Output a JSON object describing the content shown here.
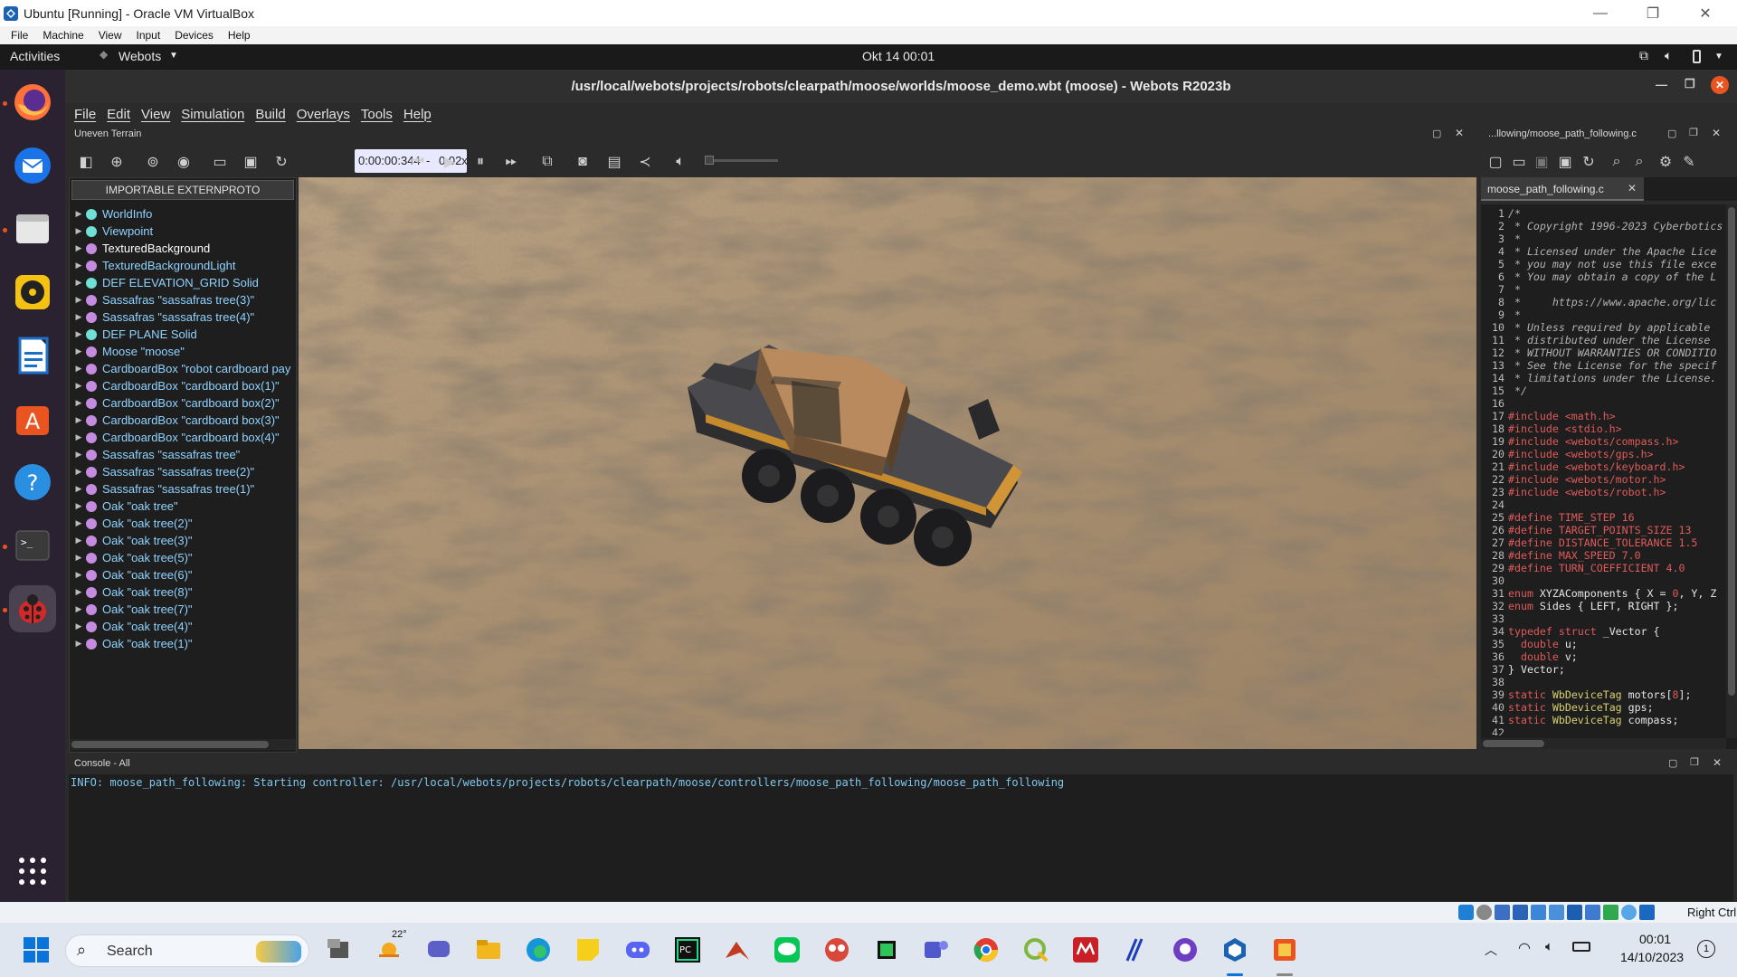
{
  "vbox": {
    "title": "Ubuntu [Running] - Oracle VM VirtualBox",
    "menu": [
      "File",
      "Machine",
      "View",
      "Input",
      "Devices",
      "Help"
    ],
    "host_key": "Right Ctrl"
  },
  "ubuntu": {
    "activities": "Activities",
    "app": "Webots",
    "clock": "Okt 14  00:01"
  },
  "webots": {
    "title": "/usr/local/webots/projects/robots/clearpath/moose/worlds/moose_demo.wbt (moose) - Webots R2023b",
    "menu": [
      "File",
      "Edit",
      "View",
      "Simulation",
      "Build",
      "Overlays",
      "Tools",
      "Help"
    ],
    "world_label": "Uneven Terrain",
    "time": "0:00:00:344",
    "speed_sep": "-",
    "speed": "0.02x",
    "importable_btn": "IMPORTABLE EXTERNPROTO",
    "tree": [
      {
        "label": "WorldInfo",
        "color": "#6ee0d6",
        "bright": false
      },
      {
        "label": "Viewpoint",
        "color": "#6ee0d6",
        "bright": false
      },
      {
        "label": "TexturedBackground",
        "color": "#c58be0",
        "bright": true
      },
      {
        "label": "TexturedBackgroundLight",
        "color": "#c58be0",
        "bright": false
      },
      {
        "label": "DEF ELEVATION_GRID Solid",
        "color": "#6ee0d6",
        "bright": false
      },
      {
        "label": "Sassafras \"sassafras tree(3)\"",
        "color": "#c58be0",
        "bright": false
      },
      {
        "label": "Sassafras \"sassafras tree(4)\"",
        "color": "#c58be0",
        "bright": false
      },
      {
        "label": "DEF PLANE Solid",
        "color": "#6ee0d6",
        "bright": false
      },
      {
        "label": "Moose \"moose\"",
        "color": "#c58be0",
        "bright": false
      },
      {
        "label": "CardboardBox \"robot cardboard pay",
        "color": "#c58be0",
        "bright": false
      },
      {
        "label": "CardboardBox \"cardboard box(1)\"",
        "color": "#c58be0",
        "bright": false
      },
      {
        "label": "CardboardBox \"cardboard box(2)\"",
        "color": "#c58be0",
        "bright": false
      },
      {
        "label": "CardboardBox \"cardboard box(3)\"",
        "color": "#c58be0",
        "bright": false
      },
      {
        "label": "CardboardBox \"cardboard box(4)\"",
        "color": "#c58be0",
        "bright": false
      },
      {
        "label": "Sassafras \"sassafras tree\"",
        "color": "#c58be0",
        "bright": false
      },
      {
        "label": "Sassafras \"sassafras tree(2)\"",
        "color": "#c58be0",
        "bright": false
      },
      {
        "label": "Sassafras \"sassafras tree(1)\"",
        "color": "#c58be0",
        "bright": false
      },
      {
        "label": "Oak \"oak tree\"",
        "color": "#c58be0",
        "bright": false
      },
      {
        "label": "Oak \"oak tree(2)\"",
        "color": "#c58be0",
        "bright": false
      },
      {
        "label": "Oak \"oak tree(3)\"",
        "color": "#c58be0",
        "bright": false
      },
      {
        "label": "Oak \"oak tree(5)\"",
        "color": "#c58be0",
        "bright": false
      },
      {
        "label": "Oak \"oak tree(6)\"",
        "color": "#c58be0",
        "bright": false
      },
      {
        "label": "Oak \"oak tree(8)\"",
        "color": "#c58be0",
        "bright": false
      },
      {
        "label": "Oak \"oak tree(7)\"",
        "color": "#c58be0",
        "bright": false
      },
      {
        "label": "Oak \"oak tree(4)\"",
        "color": "#c58be0",
        "bright": false
      },
      {
        "label": "Oak \"oak tree(1)\"",
        "color": "#c58be0",
        "bright": false
      }
    ],
    "editor_panel_title": "...llowing/moose_path_following.c",
    "editor_tab": "moose_path_following.c",
    "code": [
      {
        "n": "1",
        "segs": [
          {
            "t": "/*",
            "c": "cm"
          }
        ]
      },
      {
        "n": "2",
        "segs": [
          {
            "t": " * Copyright 1996-2023 Cyberbotics",
            "c": "cm"
          }
        ]
      },
      {
        "n": "3",
        "segs": [
          {
            "t": " *",
            "c": "cm"
          }
        ]
      },
      {
        "n": "4",
        "segs": [
          {
            "t": " * Licensed under the Apache Lice",
            "c": "cm"
          }
        ]
      },
      {
        "n": "5",
        "segs": [
          {
            "t": " * you may not use this file exce",
            "c": "cm"
          }
        ]
      },
      {
        "n": "6",
        "segs": [
          {
            "t": " * You may obtain a copy of the L",
            "c": "cm"
          }
        ]
      },
      {
        "n": "7",
        "segs": [
          {
            "t": " *",
            "c": "cm"
          }
        ]
      },
      {
        "n": "8",
        "segs": [
          {
            "t": " *     https://www.apache.org/lic",
            "c": "cm"
          }
        ]
      },
      {
        "n": "9",
        "segs": [
          {
            "t": " *",
            "c": "cm"
          }
        ]
      },
      {
        "n": "10",
        "segs": [
          {
            "t": " * Unless required by applicable",
            "c": "cm"
          }
        ]
      },
      {
        "n": "11",
        "segs": [
          {
            "t": " * distributed under the License",
            "c": "cm"
          }
        ]
      },
      {
        "n": "12",
        "segs": [
          {
            "t": " * WITHOUT WARRANTIES OR CONDITIO",
            "c": "cm"
          }
        ]
      },
      {
        "n": "13",
        "segs": [
          {
            "t": " * See the License for the specif",
            "c": "cm"
          }
        ]
      },
      {
        "n": "14",
        "segs": [
          {
            "t": " * limitations under the License.",
            "c": "cm"
          }
        ]
      },
      {
        "n": "15",
        "segs": [
          {
            "t": " */",
            "c": "cm"
          }
        ]
      },
      {
        "n": "16",
        "segs": []
      },
      {
        "n": "17",
        "segs": [
          {
            "t": "#include <math.h>",
            "c": "pp"
          }
        ]
      },
      {
        "n": "18",
        "segs": [
          {
            "t": "#include <stdio.h>",
            "c": "pp"
          }
        ]
      },
      {
        "n": "19",
        "segs": [
          {
            "t": "#include <webots/compass.h>",
            "c": "pp"
          }
        ]
      },
      {
        "n": "20",
        "segs": [
          {
            "t": "#include <webots/gps.h>",
            "c": "pp"
          }
        ]
      },
      {
        "n": "21",
        "segs": [
          {
            "t": "#include <webots/keyboard.h>",
            "c": "pp"
          }
        ]
      },
      {
        "n": "22",
        "segs": [
          {
            "t": "#include <webots/motor.h>",
            "c": "pp"
          }
        ]
      },
      {
        "n": "23",
        "segs": [
          {
            "t": "#include <webots/robot.h>",
            "c": "pp"
          }
        ]
      },
      {
        "n": "24",
        "segs": []
      },
      {
        "n": "25",
        "segs": [
          {
            "t": "#define TIME_STEP 16",
            "c": "pp"
          }
        ]
      },
      {
        "n": "26",
        "segs": [
          {
            "t": "#define TARGET_POINTS_SIZE 13",
            "c": "pp"
          }
        ]
      },
      {
        "n": "27",
        "segs": [
          {
            "t": "#define DISTANCE_TOLERANCE 1.5",
            "c": "pp"
          }
        ]
      },
      {
        "n": "28",
        "segs": [
          {
            "t": "#define MAX_SPEED 7.0",
            "c": "pp"
          }
        ]
      },
      {
        "n": "29",
        "segs": [
          {
            "t": "#define TURN_COEFFICIENT 4.0",
            "c": "pp"
          }
        ]
      },
      {
        "n": "30",
        "segs": []
      },
      {
        "n": "31",
        "segs": [
          {
            "t": "enum",
            "c": "kw"
          },
          {
            "t": " XYZAComponents { X = ",
            "c": "tx"
          },
          {
            "t": "0",
            "c": "nm"
          },
          {
            "t": ", Y, Z",
            "c": "tx"
          }
        ]
      },
      {
        "n": "32",
        "segs": [
          {
            "t": "enum",
            "c": "kw"
          },
          {
            "t": " Sides { LEFT, RIGHT };",
            "c": "tx"
          }
        ]
      },
      {
        "n": "33",
        "segs": []
      },
      {
        "n": "34",
        "segs": [
          {
            "t": "typedef struct",
            "c": "kw"
          },
          {
            "t": " _Vector {",
            "c": "tx"
          }
        ]
      },
      {
        "n": "35",
        "segs": [
          {
            "t": "  double",
            "c": "kw"
          },
          {
            "t": " u;",
            "c": "tx"
          }
        ]
      },
      {
        "n": "36",
        "segs": [
          {
            "t": "  double",
            "c": "kw"
          },
          {
            "t": " v;",
            "c": "tx"
          }
        ]
      },
      {
        "n": "37",
        "segs": [
          {
            "t": "} Vector;",
            "c": "tx"
          }
        ]
      },
      {
        "n": "38",
        "segs": []
      },
      {
        "n": "39",
        "segs": [
          {
            "t": "static",
            "c": "kw"
          },
          {
            "t": " ",
            "c": "tx"
          },
          {
            "t": "WbDeviceTag",
            "c": "ty"
          },
          {
            "t": " motors[",
            "c": "tx"
          },
          {
            "t": "8",
            "c": "nm"
          },
          {
            "t": "];",
            "c": "tx"
          }
        ]
      },
      {
        "n": "40",
        "segs": [
          {
            "t": "static",
            "c": "kw"
          },
          {
            "t": " ",
            "c": "tx"
          },
          {
            "t": "WbDeviceTag",
            "c": "ty"
          },
          {
            "t": " gps;",
            "c": "tx"
          }
        ]
      },
      {
        "n": "41",
        "segs": [
          {
            "t": "static",
            "c": "kw"
          },
          {
            "t": " ",
            "c": "tx"
          },
          {
            "t": "WbDeviceTag",
            "c": "ty"
          },
          {
            "t": " compass;",
            "c": "tx"
          }
        ]
      },
      {
        "n": "42",
        "segs": []
      }
    ],
    "console_title": "Console - All",
    "console_line": "INFO: moose_path_following: Starting controller: /usr/local/webots/projects/robots/clearpath/moose/controllers/moose_path_following/moose_path_following"
  },
  "taskbar": {
    "search": "Search",
    "weather": "22°",
    "time": "00:01",
    "date": "14/10/2023",
    "notif_count": "1"
  },
  "colors": {
    "comment": "#b3b3b3",
    "preproc": "#e05a5a",
    "keyword": "#e05a5a",
    "type": "#d8d070",
    "number": "#e05a5a",
    "text": "#e6e6e6",
    "console_info": "#7fc8ee",
    "ubuntu_orange": "#e95420"
  }
}
